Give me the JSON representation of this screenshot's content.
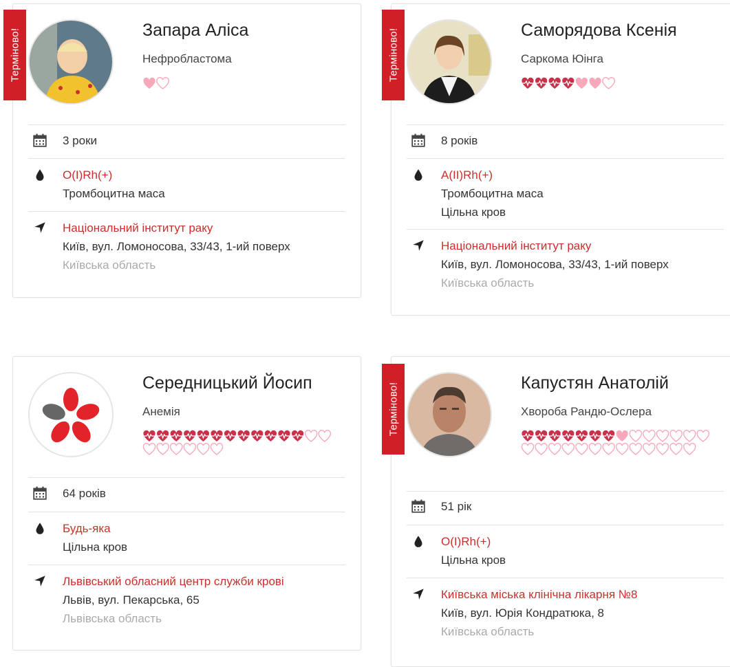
{
  "colors": {
    "accent": "#c9302c",
    "badge": "#d01f26",
    "heart_filled": "#c9314a",
    "heart_light": "#f7a9bb"
  },
  "urgent_label": "Терміново!",
  "cards": [
    {
      "name": "Запара Аліса",
      "diagnosis": "Нефробластома",
      "age": "3 роки",
      "blood_type": "O(I)Rh(+)",
      "components": [
        "Тромбоцитна маса"
      ],
      "hospital": "Національний інститут раку",
      "address": "Київ, вул. Ломоносова, 33/43, 1-ий поверх",
      "region": "Київська область",
      "hearts": {
        "filled": 0,
        "pink": 1,
        "empty": 1
      }
    },
    {
      "name": "Саморядова Ксенія",
      "diagnosis": "Саркома Юінга",
      "age": "8 років",
      "blood_type": "A(II)Rh(+)",
      "components": [
        "Тромбоцитна маса",
        "Цільна кров"
      ],
      "hospital": "Національний інститут раку",
      "address": "Київ, вул. Ломоносова, 33/43, 1-ий поверх",
      "region": "Київська область",
      "hearts": {
        "filled": 4,
        "pink": 2,
        "empty": 1
      }
    },
    {
      "name": "Середницький Йосип",
      "diagnosis": "Анемія",
      "age": "64 років",
      "blood_type": "Будь-яка",
      "components": [
        "Цільна кров"
      ],
      "hospital": "Львівський обласний центр служби крові",
      "address": "Львів, вул. Пекарська, 65",
      "region": "Львівська область",
      "hearts": {
        "filled": 12,
        "pink": 0,
        "empty": 8
      }
    },
    {
      "name": "Капустян Анатолій",
      "diagnosis": "Хвороба Рандю-Ослера",
      "age": "51 рік",
      "blood_type": "O(I)Rh(+)",
      "components": [
        "Цільна кров"
      ],
      "hospital": "Київська міська клінічна лікарня №8",
      "address": "Київ, вул. Юрія Кондратюка, 8",
      "region": "Київська область",
      "hearts": {
        "filled": 7,
        "pink": 1,
        "empty": 19
      }
    }
  ]
}
